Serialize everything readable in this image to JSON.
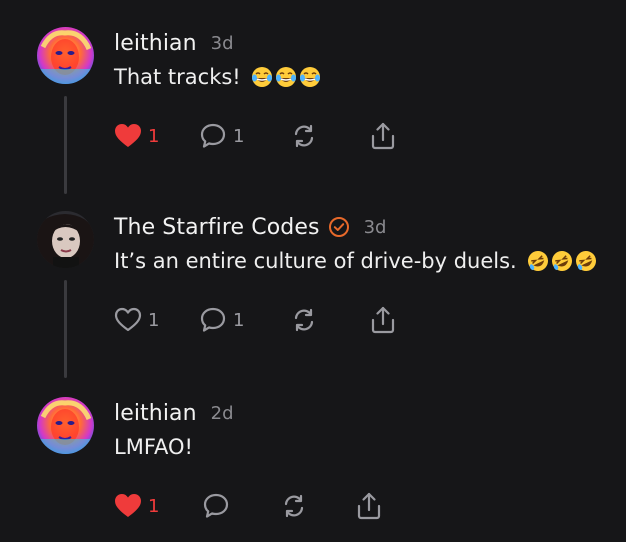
{
  "colors": {
    "background": "#161618",
    "liked": "#ef3b3b",
    "muted": "#8a8a8f",
    "verified": "#e8692a",
    "thread_line": "#3a3a3e"
  },
  "posts": [
    {
      "author": "leithian",
      "time": "3d",
      "verified": false,
      "text": "That tracks!",
      "emoji": [
        "face-with-tears-of-joy",
        "face-with-tears-of-joy",
        "face-with-tears-of-joy"
      ],
      "liked": true,
      "like_count": "1",
      "reply_count": "1",
      "avatar": "colorful-face-avatar"
    },
    {
      "author": "The Starfire Codes",
      "time": "3d",
      "verified": true,
      "text": "It’s an entire culture of drive-by duels.",
      "emoji": [
        "rolling-on-floor-laughing",
        "rolling-on-floor-laughing",
        "rolling-on-floor-laughing"
      ],
      "liked": false,
      "like_count": "1",
      "reply_count": "1",
      "avatar": "woman-portrait-avatar"
    },
    {
      "author": "leithian",
      "time": "2d",
      "verified": false,
      "text": "LMFAO!",
      "emoji": [],
      "liked": true,
      "like_count": "1",
      "reply_count": "",
      "avatar": "colorful-face-avatar"
    }
  ]
}
